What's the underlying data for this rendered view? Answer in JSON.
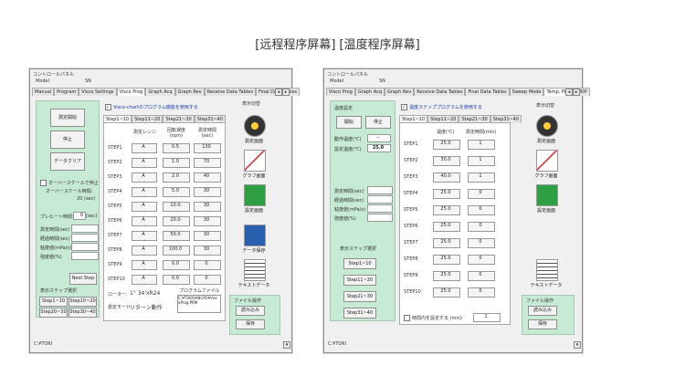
{
  "caption": "[远程程序屏幕] [温度程序屏幕]",
  "windows": [
    {
      "title": "コントロールパネル",
      "model_label": "Model",
      "sn_label": "SN",
      "tabs": [
        "Manual",
        "Program",
        "Visco Settings",
        "Visco Prog",
        "Graph Acq",
        "Graph Rev",
        "Receive Data Tables",
        "Final Data Tables"
      ],
      "active_tab_index": 3,
      "left": {
        "start_button": "測定開始",
        "stop_button": "停止",
        "clear_button": "データクリア",
        "overscale_check": "オーバースケールで停止",
        "overscale_time_label": "オーバースケール時間:",
        "overscale_time_value": "20",
        "overscale_time_unit": "(sec)",
        "preheat_label": "プレヒート時間:",
        "preheat_value": "0",
        "preheat_unit": "(sec)",
        "fields": [
          "測定時間(sec)",
          "経過時間(sec)",
          "粘度値(mPa/s)",
          "強度値(%)"
        ],
        "next_step_button": "Next Step",
        "display_step_label": "表示ステップ選択",
        "step_buttons": [
          "Step1~10",
          "Step10~20",
          "Step20~30",
          "Step30~40"
        ]
      },
      "main": {
        "use_program_check": "Visco-chartのプログラム機能を使用する",
        "subtabs": [
          "Step1~10",
          "Step11~20",
          "Step21~30",
          "Step31~40"
        ],
        "headers": [
          "測定レンジ",
          "回転速度\n(rpm)",
          "測定時間\n(sec)"
        ],
        "rows": [
          {
            "step": "STEP1",
            "range": "A",
            "speed": "0.5",
            "time": "130"
          },
          {
            "step": "STEP2",
            "range": "A",
            "speed": "1.0",
            "time": "70"
          },
          {
            "step": "STEP3",
            "range": "A",
            "speed": "2.0",
            "time": "40"
          },
          {
            "step": "STEP4",
            "range": "A",
            "speed": "5.0",
            "time": "30"
          },
          {
            "step": "STEP5",
            "range": "A",
            "speed": "10.0",
            "time": "30"
          },
          {
            "step": "STEP6",
            "range": "A",
            "speed": "20.0",
            "time": "30"
          },
          {
            "step": "STEP7",
            "range": "A",
            "speed": "50.0",
            "time": "30"
          },
          {
            "step": "STEP8",
            "range": "A",
            "speed": "100.0",
            "time": "30"
          },
          {
            "step": "STEP9",
            "range": "A",
            "speed": "0.0",
            "time": "0"
          },
          {
            "step": "STEP10",
            "range": "A",
            "speed": "0.0",
            "time": "0"
          }
        ],
        "rotor_label": "ローター:",
        "rotor_value": "1° 34'xR24",
        "mode_label": "測定モード:",
        "mode_value": "リターン動作",
        "file_label": "プログラムファイル名:",
        "file_value": "C:¥TOKISANGYO¥ViscoProg.PRM"
      },
      "right": {
        "display_switch": "表示切替",
        "items": [
          "測定画面",
          "グラフ画面",
          "設定画面",
          "データ保存",
          "テキストデータ"
        ],
        "file_ops": "ファイル操作",
        "load_button": "読み込み",
        "save_button": "保存"
      },
      "status": "C:¥TOKI"
    },
    {
      "title": "コントロールパネル",
      "model_label": "Model",
      "sn_label": "SN",
      "tabs": [
        "Visco Prog",
        "Graph Acq",
        "Graph Rev",
        "Receive Data Tables",
        "Final Data Tables",
        "Sweep Mode",
        "Temp. Prog",
        "UDP"
      ],
      "active_tab_index": 6,
      "left": {
        "temp_settings": "温度設定",
        "start_button": "開始",
        "stop_button": "停止",
        "operating_temp_label": "動作温度(℃)",
        "operating_temp_value": "--",
        "set_temp_label": "設定温度(℃)",
        "set_temp_value": "25.0",
        "fields": [
          "測定時間(sec)",
          "経過時間(sec)",
          "粘度値(mPa/s)",
          "強度値(%)"
        ],
        "display_step_label": "表示ステップ選択",
        "step_buttons": [
          "Step1~10",
          "Step11~20",
          "Step21~30",
          "Step31~40"
        ]
      },
      "main": {
        "use_program_check": "温度ステッププログラムを使用する",
        "subtabs": [
          "Step1~10",
          "Step11~20",
          "Step21~30",
          "Step31~40"
        ],
        "headers": [
          "温度(℃)",
          "測定時間(min)"
        ],
        "rows": [
          {
            "step": "STEP1",
            "temp": "25.0",
            "time": "1"
          },
          {
            "step": "STEP2",
            "temp": "30.0",
            "time": "1"
          },
          {
            "step": "STEP3",
            "temp": "40.0",
            "time": "1"
          },
          {
            "step": "STEP4",
            "temp": "25.0",
            "time": "0"
          },
          {
            "step": "STEP5",
            "temp": "25.0",
            "time": "0"
          },
          {
            "step": "STEP6",
            "temp": "25.0",
            "time": "0"
          },
          {
            "step": "STEP7",
            "temp": "25.0",
            "time": "0"
          },
          {
            "step": "STEP8",
            "temp": "25.0",
            "time": "0"
          },
          {
            "step": "STEP9",
            "temp": "25.0",
            "time": "0"
          },
          {
            "step": "STEP10",
            "temp": "25.0",
            "time": "0"
          }
        ],
        "loop_label": "時間内を設定する (min)",
        "loop_value": "1"
      },
      "right": {
        "display_switch": "表示切替",
        "items": [
          "測定画面",
          "グラフ画面",
          "設定画面",
          "テキストデータ"
        ],
        "file_ops": "ファイル操作",
        "load_button": "読み込み",
        "save_button": "保存"
      },
      "status": "C:¥TOKI"
    }
  ]
}
